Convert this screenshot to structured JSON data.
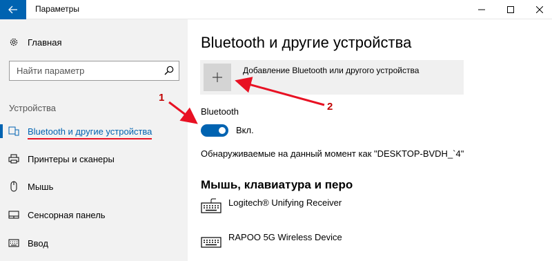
{
  "window": {
    "title": "Параметры",
    "back_icon": "arrow-left-icon",
    "accent": "#0063b1"
  },
  "sidebar": {
    "home_label": "Главная",
    "search_placeholder": "Найти параметр",
    "section_label": "Устройства",
    "items": [
      {
        "label": "Bluetooth и другие устройства",
        "icon": "bluetooth-devices-icon",
        "active": true
      },
      {
        "label": "Принтеры и сканеры",
        "icon": "printer-icon",
        "active": false
      },
      {
        "label": "Мышь",
        "icon": "mouse-icon",
        "active": false
      },
      {
        "label": "Сенсорная панель",
        "icon": "touchpad-icon",
        "active": false
      },
      {
        "label": "Ввод",
        "icon": "keyboard-icon",
        "active": false
      }
    ]
  },
  "main": {
    "title": "Bluetooth и другие устройства",
    "add_device_label": "Добавление Bluetooth или другого устройства",
    "bluetooth_label": "Bluetooth",
    "bluetooth_toggle_text": "Вкл.",
    "bluetooth_on": true,
    "discoverable_text": "Обнаруживаемые на данный момент как \"DESKTOP-BVDH_`4\"",
    "section_title": "Мышь, клавиатура и перо",
    "devices": [
      {
        "name": "Logitech® Unifying Receiver",
        "icon": "keyboard-icon"
      },
      {
        "name": "RAPOO 5G Wireless Device",
        "icon": "keyboard-icon"
      }
    ]
  },
  "annotations": {
    "marker_1": "1",
    "marker_2": "2",
    "color": "#e81123"
  }
}
